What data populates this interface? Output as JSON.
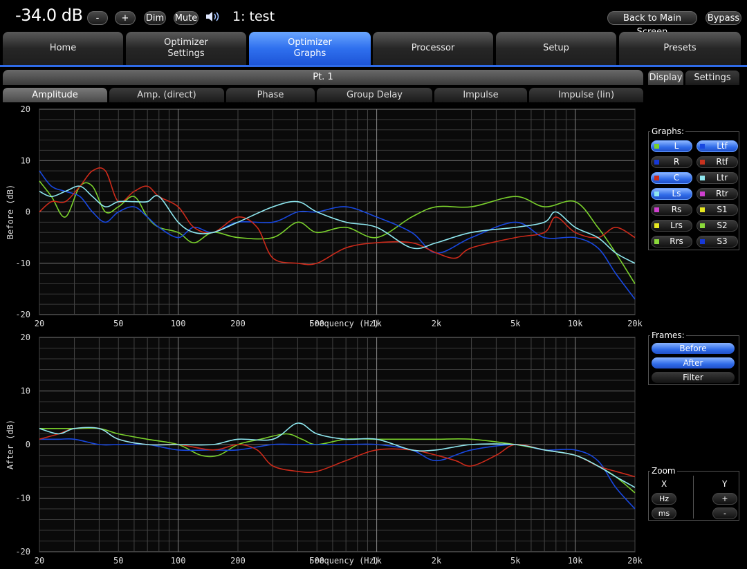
{
  "header": {
    "volume": "-34.0 dB",
    "minus_label": "-",
    "plus_label": "+",
    "dim_label": "Dim",
    "mute_label": "Mute",
    "preset_name": "1: test",
    "back_label": "Back to Main Screen",
    "bypass_label": "Bypass"
  },
  "tabs": [
    {
      "label": "Home",
      "active": false
    },
    {
      "label": "Optimizer\nSettings",
      "active": false
    },
    {
      "label": "Optimizer\nGraphs",
      "active": true
    },
    {
      "label": "Processor",
      "active": false
    },
    {
      "label": "Setup",
      "active": false
    },
    {
      "label": "Presets",
      "active": false
    }
  ],
  "point_label": "Pt. 1",
  "subtabs": [
    "Amplitude",
    "Amp. (direct)",
    "Phase",
    "Group Delay",
    "Impulse",
    "Impulse (lin)"
  ],
  "side_tabs": [
    "Display",
    "Settings"
  ],
  "graphs_panel": {
    "title": "Graphs:",
    "items": [
      {
        "label": "L",
        "color": "#7ad12c",
        "on": true
      },
      {
        "label": "Ltf",
        "color": "#1848e0",
        "on": true
      },
      {
        "label": "R",
        "color": "#1638d8",
        "on": false
      },
      {
        "label": "Rtf",
        "color": "#c8321e",
        "on": false
      },
      {
        "label": "C",
        "color": "#cc2a1a",
        "on": true
      },
      {
        "label": "Ltr",
        "color": "#8fe8f0",
        "on": false
      },
      {
        "label": "Ls",
        "color": "#8fe8f0",
        "on": true
      },
      {
        "label": "Rtr",
        "color": "#d040d0",
        "on": false
      },
      {
        "label": "Rs",
        "color": "#d040d0",
        "on": false
      },
      {
        "label": "S1",
        "color": "#e8e820",
        "on": false
      },
      {
        "label": "Lrs",
        "color": "#e8e820",
        "on": false
      },
      {
        "label": "S2",
        "color": "#8ad83a",
        "on": false
      },
      {
        "label": "Rrs",
        "color": "#8ad83a",
        "on": false
      },
      {
        "label": "S3",
        "color": "#1638d8",
        "on": false
      }
    ]
  },
  "frames_panel": {
    "title": "Frames:",
    "items": [
      {
        "label": "Before",
        "on": true
      },
      {
        "label": "After",
        "on": true
      },
      {
        "label": "Filter",
        "on": false
      }
    ]
  },
  "zoom_panel": {
    "title": "Zoom",
    "x_label": "X",
    "y_label": "Y",
    "hz_label": "Hz",
    "ms_label": "ms",
    "plus_label": "+",
    "minus_label": "-"
  },
  "chart_data": [
    {
      "type": "line",
      "xlabel": "Frequency (Hz)",
      "ylabel": "Before (dB)",
      "xscale": "log",
      "xlim": [
        20,
        20000
      ],
      "ylim": [
        -20,
        20
      ],
      "x_ticks": [
        "20",
        "50",
        "100",
        "200",
        "500",
        "1k",
        "2k",
        "5k",
        "10k",
        "20k"
      ],
      "y_ticks": [
        "20",
        "10",
        "0",
        "-10",
        "-20"
      ],
      "grid": true,
      "series": [
        {
          "name": "L",
          "color": "#7ad12c",
          "points": [
            [
              20,
              6
            ],
            [
              23,
              3
            ],
            [
              27,
              -1
            ],
            [
              32,
              5
            ],
            [
              37,
              5
            ],
            [
              43,
              0
            ],
            [
              50,
              1
            ],
            [
              60,
              3
            ],
            [
              70,
              -1
            ],
            [
              80,
              -3
            ],
            [
              100,
              -4
            ],
            [
              120,
              -6
            ],
            [
              150,
              -4
            ],
            [
              200,
              -5
            ],
            [
              300,
              -5
            ],
            [
              400,
              -2
            ],
            [
              500,
              -4
            ],
            [
              700,
              -3
            ],
            [
              1000,
              -5
            ],
            [
              1500,
              -1
            ],
            [
              2000,
              1
            ],
            [
              3000,
              1
            ],
            [
              5000,
              3
            ],
            [
              7000,
              1
            ],
            [
              10000,
              2
            ],
            [
              13000,
              -3
            ],
            [
              16000,
              -8
            ],
            [
              20000,
              -14
            ]
          ]
        },
        {
          "name": "Ltf",
          "color": "#1848e0",
          "points": [
            [
              20,
              8
            ],
            [
              23,
              5
            ],
            [
              27,
              4
            ],
            [
              32,
              3
            ],
            [
              37,
              0
            ],
            [
              43,
              -2
            ],
            [
              50,
              0
            ],
            [
              60,
              1
            ],
            [
              70,
              -1
            ],
            [
              80,
              -3
            ],
            [
              100,
              -5
            ],
            [
              120,
              -3
            ],
            [
              150,
              -4
            ],
            [
              200,
              -2
            ],
            [
              300,
              -2
            ],
            [
              400,
              0
            ],
            [
              500,
              0
            ],
            [
              700,
              1
            ],
            [
              1000,
              -1
            ],
            [
              1500,
              -4
            ],
            [
              2000,
              -8
            ],
            [
              3000,
              -5
            ],
            [
              5000,
              -2
            ],
            [
              7000,
              -5
            ],
            [
              10000,
              -5
            ],
            [
              13000,
              -7
            ],
            [
              16000,
              -12
            ],
            [
              20000,
              -17
            ]
          ]
        },
        {
          "name": "C",
          "color": "#cc2a1a",
          "points": [
            [
              20,
              0
            ],
            [
              23,
              2
            ],
            [
              27,
              2
            ],
            [
              32,
              5
            ],
            [
              37,
              8
            ],
            [
              43,
              8
            ],
            [
              50,
              2
            ],
            [
              60,
              4
            ],
            [
              70,
              5
            ],
            [
              80,
              3
            ],
            [
              100,
              1
            ],
            [
              120,
              -3
            ],
            [
              150,
              -4
            ],
            [
              200,
              -1
            ],
            [
              250,
              -3
            ],
            [
              300,
              -9
            ],
            [
              400,
              -10
            ],
            [
              500,
              -10
            ],
            [
              700,
              -7
            ],
            [
              1000,
              -6
            ],
            [
              1500,
              -6
            ],
            [
              2000,
              -8
            ],
            [
              2500,
              -9
            ],
            [
              3000,
              -7
            ],
            [
              5000,
              -5
            ],
            [
              7000,
              -4
            ],
            [
              8000,
              -1
            ],
            [
              10000,
              -4
            ],
            [
              13000,
              -5
            ],
            [
              16000,
              -3
            ],
            [
              20000,
              -5
            ]
          ]
        },
        {
          "name": "Ls",
          "color": "#8fe8f0",
          "points": [
            [
              20,
              4
            ],
            [
              23,
              3
            ],
            [
              27,
              4
            ],
            [
              32,
              5
            ],
            [
              37,
              3
            ],
            [
              43,
              1
            ],
            [
              50,
              2
            ],
            [
              60,
              2
            ],
            [
              70,
              2
            ],
            [
              80,
              3
            ],
            [
              100,
              -2
            ],
            [
              120,
              -4
            ],
            [
              150,
              -4
            ],
            [
              200,
              -2
            ],
            [
              300,
              1
            ],
            [
              400,
              2
            ],
            [
              500,
              0
            ],
            [
              700,
              -2
            ],
            [
              1000,
              -3
            ],
            [
              1500,
              -7
            ],
            [
              2000,
              -6
            ],
            [
              3000,
              -4
            ],
            [
              5000,
              -3
            ],
            [
              7000,
              -2
            ],
            [
              8000,
              0
            ],
            [
              10000,
              -3
            ],
            [
              13000,
              -5
            ],
            [
              16000,
              -8
            ],
            [
              20000,
              -10
            ]
          ]
        }
      ]
    },
    {
      "type": "line",
      "xlabel": "Frequency (Hz)",
      "ylabel": "After (dB)",
      "xscale": "log",
      "xlim": [
        20,
        20000
      ],
      "ylim": [
        -20,
        20
      ],
      "x_ticks": [
        "20",
        "50",
        "100",
        "200",
        "500",
        "1k",
        "2k",
        "5k",
        "10k",
        "20k"
      ],
      "y_ticks": [
        "20",
        "10",
        "0",
        "-10",
        "-20"
      ],
      "grid": true,
      "series": [
        {
          "name": "L",
          "color": "#7ad12c",
          "points": [
            [
              20,
              3
            ],
            [
              25,
              3
            ],
            [
              30,
              3
            ],
            [
              40,
              3
            ],
            [
              50,
              2
            ],
            [
              70,
              1
            ],
            [
              100,
              0
            ],
            [
              130,
              -2
            ],
            [
              160,
              -2
            ],
            [
              200,
              0
            ],
            [
              260,
              1
            ],
            [
              350,
              2
            ],
            [
              420,
              1
            ],
            [
              500,
              0
            ],
            [
              700,
              1
            ],
            [
              1000,
              1
            ],
            [
              1500,
              1
            ],
            [
              2000,
              1
            ],
            [
              3000,
              1
            ],
            [
              5000,
              0
            ],
            [
              7000,
              -1
            ],
            [
              10000,
              -2
            ],
            [
              13000,
              -4
            ],
            [
              16000,
              -6
            ],
            [
              20000,
              -9
            ]
          ]
        },
        {
          "name": "Ltf",
          "color": "#1848e0",
          "points": [
            [
              20,
              1
            ],
            [
              25,
              1
            ],
            [
              30,
              1
            ],
            [
              40,
              0
            ],
            [
              50,
              0
            ],
            [
              70,
              0
            ],
            [
              100,
              -1
            ],
            [
              150,
              -1
            ],
            [
              200,
              -1
            ],
            [
              300,
              0
            ],
            [
              400,
              0
            ],
            [
              500,
              0
            ],
            [
              700,
              0
            ],
            [
              1000,
              0
            ],
            [
              1500,
              -1
            ],
            [
              2000,
              -3
            ],
            [
              3000,
              -1
            ],
            [
              5000,
              0
            ],
            [
              7000,
              -1
            ],
            [
              10000,
              -1
            ],
            [
              13000,
              -3
            ],
            [
              16000,
              -8
            ],
            [
              20000,
              -12
            ]
          ]
        },
        {
          "name": "C",
          "color": "#cc2a1a",
          "points": [
            [
              20,
              1
            ],
            [
              25,
              2
            ],
            [
              30,
              3
            ],
            [
              40,
              3
            ],
            [
              50,
              1
            ],
            [
              70,
              0
            ],
            [
              100,
              0
            ],
            [
              150,
              -1
            ],
            [
              200,
              0
            ],
            [
              250,
              -1
            ],
            [
              300,
              -4
            ],
            [
              400,
              -5
            ],
            [
              500,
              -5
            ],
            [
              700,
              -3
            ],
            [
              1000,
              -1
            ],
            [
              1500,
              -1
            ],
            [
              2000,
              -2
            ],
            [
              2500,
              -3
            ],
            [
              3000,
              -4
            ],
            [
              4000,
              -2
            ],
            [
              5000,
              0
            ],
            [
              7000,
              -1
            ],
            [
              10000,
              -2
            ],
            [
              13000,
              -4
            ],
            [
              16000,
              -5
            ],
            [
              20000,
              -6
            ]
          ]
        },
        {
          "name": "Ls",
          "color": "#8fe8f0",
          "points": [
            [
              20,
              3
            ],
            [
              25,
              2
            ],
            [
              30,
              3
            ],
            [
              40,
              3
            ],
            [
              50,
              1
            ],
            [
              70,
              0
            ],
            [
              100,
              0
            ],
            [
              150,
              0
            ],
            [
              200,
              1
            ],
            [
              300,
              1
            ],
            [
              400,
              4
            ],
            [
              500,
              2
            ],
            [
              700,
              1
            ],
            [
              1000,
              1
            ],
            [
              1500,
              -1
            ],
            [
              2000,
              -1
            ],
            [
              3000,
              0
            ],
            [
              5000,
              0
            ],
            [
              7000,
              -1
            ],
            [
              10000,
              -2
            ],
            [
              13000,
              -4
            ],
            [
              16000,
              -6
            ],
            [
              20000,
              -8
            ]
          ]
        }
      ]
    }
  ]
}
